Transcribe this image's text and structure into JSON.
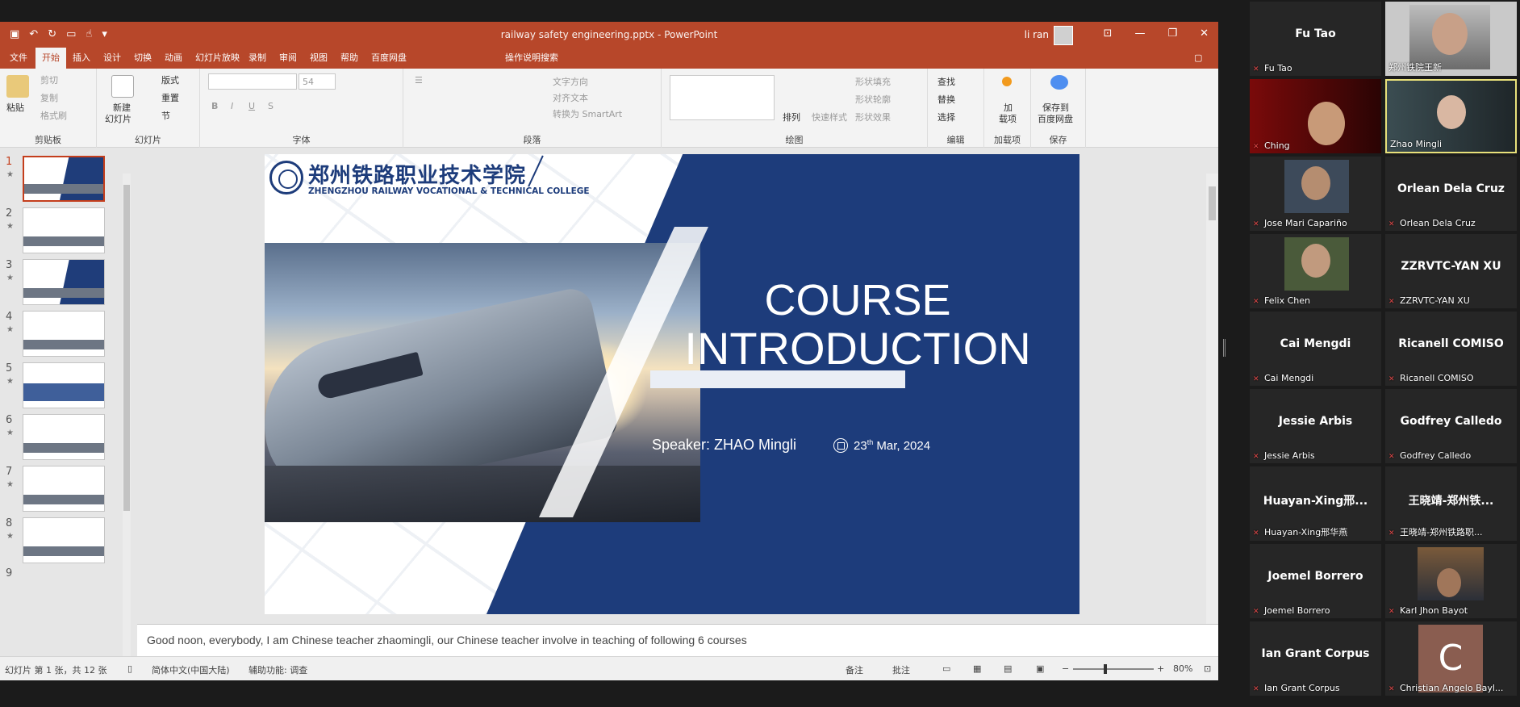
{
  "window": {
    "doc_title": "railway safety engineering.pptx  -  PowerPoint",
    "user_name": "li ran"
  },
  "tabs": [
    "文件",
    "开始",
    "插入",
    "设计",
    "切换",
    "动画",
    "幻灯片放映",
    "录制",
    "审阅",
    "视图",
    "帮助",
    "百度网盘",
    "操作说明搜索"
  ],
  "ribbon": {
    "clipboard": {
      "paste": "粘贴",
      "cut": "剪切",
      "copy": "复制",
      "format_painter": "格式刷",
      "label": "剪贴板"
    },
    "slides": {
      "new_slide": "新建",
      "new_slide2": "幻灯片",
      "layout": "版式",
      "reset": "重置",
      "section": "节",
      "label": "幻灯片"
    },
    "font": {
      "size": "54",
      "label": "字体"
    },
    "paragraph": {
      "text_dir": "文字方向",
      "align_text": "对齐文本",
      "smartart": "转换为 SmartArt",
      "label": "段落"
    },
    "drawing": {
      "arrange": "排列",
      "quick_styles": "快速样式",
      "shape_fill": "形状填充",
      "shape_outline": "形状轮廓",
      "shape_effects": "形状效果",
      "label": "绘图"
    },
    "editing": {
      "find": "查找",
      "replace": "替换",
      "select": "选择",
      "label": "编辑"
    },
    "addins": {
      "addin": "加",
      "addin2": "载项",
      "label": "加载项"
    },
    "save": {
      "save_to": "保存到",
      "save_to2": "百度网盘",
      "label": "保存"
    }
  },
  "thumbnails": [
    {
      "num": "1"
    },
    {
      "num": "2"
    },
    {
      "num": "3"
    },
    {
      "num": "4"
    },
    {
      "num": "5"
    },
    {
      "num": "6"
    },
    {
      "num": "7"
    },
    {
      "num": "8"
    },
    {
      "num": "9"
    }
  ],
  "slide": {
    "college_cn": "郑州铁路职业技术学院",
    "college_en": "ZHENGZHOU RAILWAY VOCATIONAL & TECHNICAL COLLEGE",
    "title_line1": "COURSE",
    "title_line2": "INTRODUCTION",
    "speaker": "Speaker: ZHAO Mingli",
    "date_day": "23",
    "date_sup": "th",
    "date_rest": " Mar, 2024"
  },
  "notes": "Good noon, everybody, I am Chinese teacher zhaomingli, our Chinese teacher involve in teaching of following 6 courses",
  "status": {
    "slide_info": "幻灯片 第 1 张，共 12 张",
    "language": "简体中文(中国大陆)",
    "accessibility": "辅助功能: 调查",
    "notes_btn": "备注",
    "comments_btn": "批注",
    "zoom": "80%"
  },
  "participants": [
    {
      "big": "Fu Tao",
      "label": "Fu Tao"
    },
    {
      "big": "",
      "label": "郑州铁院王新"
    },
    {
      "big": "",
      "label": "Ching"
    },
    {
      "big": "",
      "label": "Zhao Mingli"
    },
    {
      "big": "",
      "label": "Jose Mari Capariño"
    },
    {
      "big": "Orlean Dela Cruz",
      "label": "Orlean Dela Cruz"
    },
    {
      "big": "",
      "label": "Felix Chen"
    },
    {
      "big": "ZZRVTC-YAN XU",
      "label": "ZZRVTC-YAN XU"
    },
    {
      "big": "Cai Mengdi",
      "label": "Cai Mengdi"
    },
    {
      "big": "Ricanell COMISO",
      "label": "Ricanell COMISO"
    },
    {
      "big": "Jessie Arbis",
      "label": "Jessie Arbis"
    },
    {
      "big": "Godfrey Calledo",
      "label": "Godfrey Calledo"
    },
    {
      "big": "Huayan-Xing邢...",
      "label": "Huayan-Xing邢华燕"
    },
    {
      "big": "王晓靖-郑州铁...",
      "label": "王晓靖-郑州铁路职..."
    },
    {
      "big": "Joemel Borrero",
      "label": "Joemel Borrero"
    },
    {
      "big": "",
      "label": "Karl Jhon Bayot"
    },
    {
      "big": "Ian Grant Corpus",
      "label": "Ian Grant Corpus"
    },
    {
      "big": "",
      "label": "Christian Angelo Bayl..."
    }
  ],
  "avatar_letter": "C",
  "colors": {
    "accent": "#b7472a",
    "slide_blue": "#1d3c7b",
    "speaker_border": "#e8e07a"
  }
}
